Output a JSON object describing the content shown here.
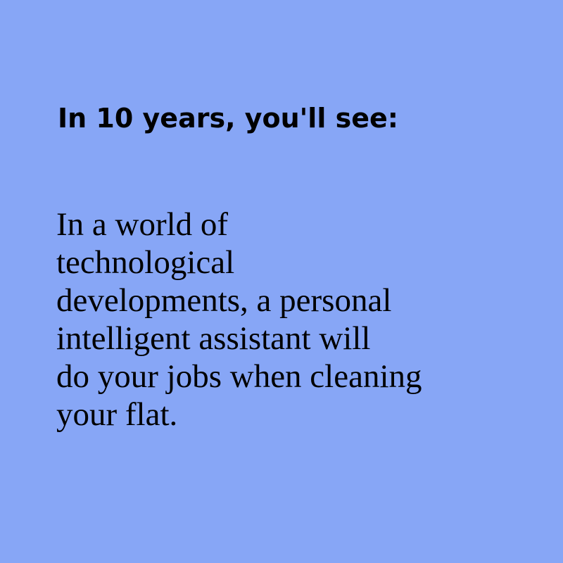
{
  "heading": "In 10 years, you'll see:",
  "body_lines": [
    "In a world of",
    "technological",
    "developments, a personal",
    "intelligent assistant will",
    "do your jobs when cleaning",
    "your flat."
  ],
  "colors": {
    "background": "#87a6f6",
    "text": "#000000"
  }
}
